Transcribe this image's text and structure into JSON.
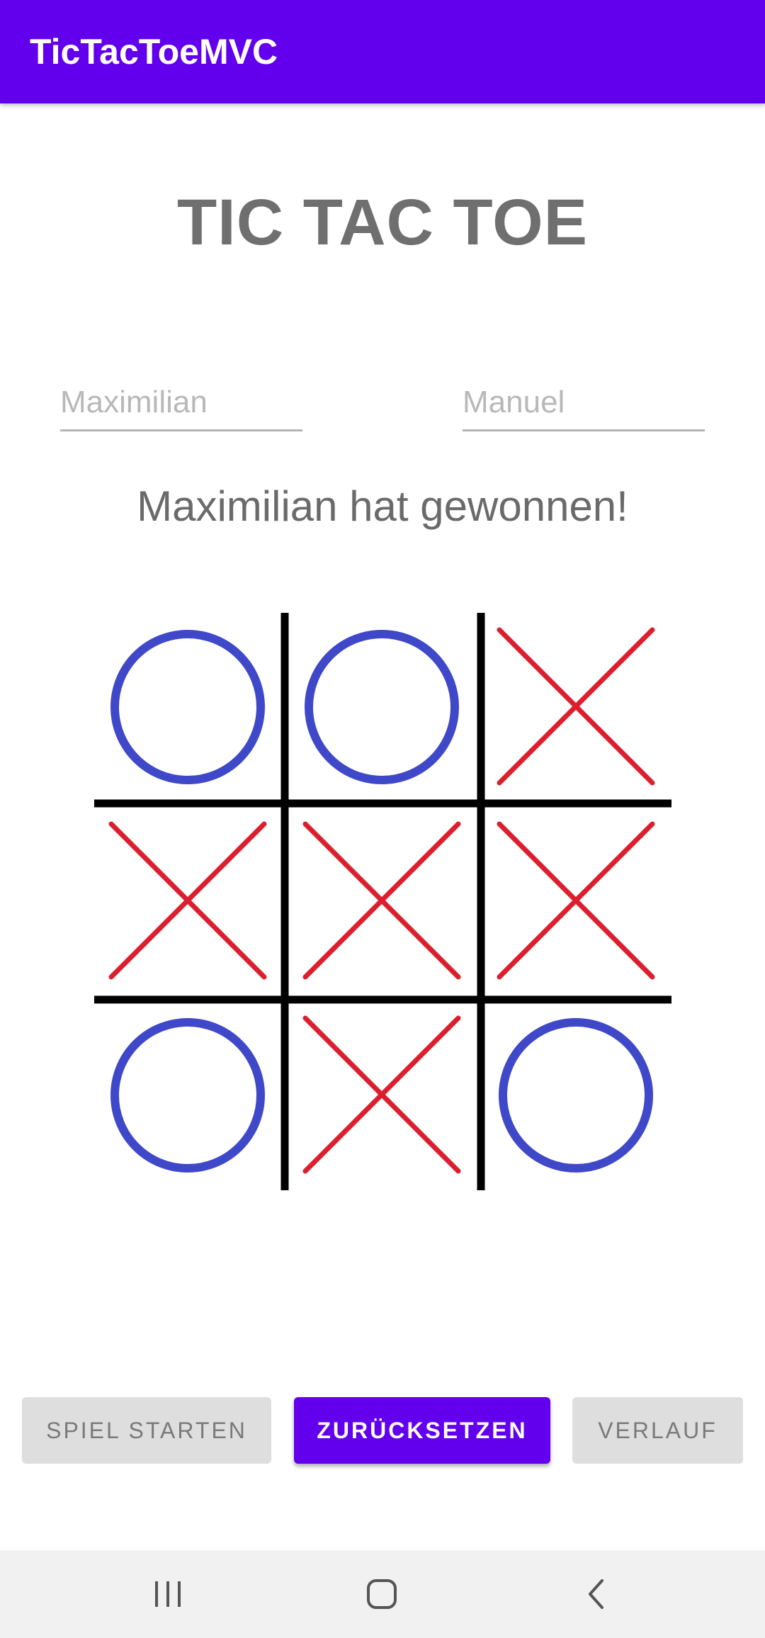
{
  "app_bar": {
    "title": "TicTacToeMVC"
  },
  "game": {
    "title": "TIC TAC TOE",
    "player1": {
      "value": "",
      "placeholder": "Maximilian"
    },
    "player2": {
      "value": "",
      "placeholder": "Manuel"
    },
    "status": "Maximilian hat gewonnen!",
    "board": [
      [
        "O",
        "O",
        "X"
      ],
      [
        "X",
        "X",
        "X"
      ],
      [
        "O",
        "X",
        "O"
      ]
    ]
  },
  "buttons": {
    "start": "SPIEL STARTEN",
    "reset": "ZURÜCKSETZEN",
    "history": "VERLAUF"
  },
  "navigation": {
    "recents_icon": "recents-icon",
    "home_icon": "home-icon",
    "back_icon": "back-icon"
  },
  "colors": {
    "primary": "#6200ee",
    "o_mark": "#3f48c8",
    "x_mark": "#dc1f2e",
    "grid": "#000000"
  }
}
